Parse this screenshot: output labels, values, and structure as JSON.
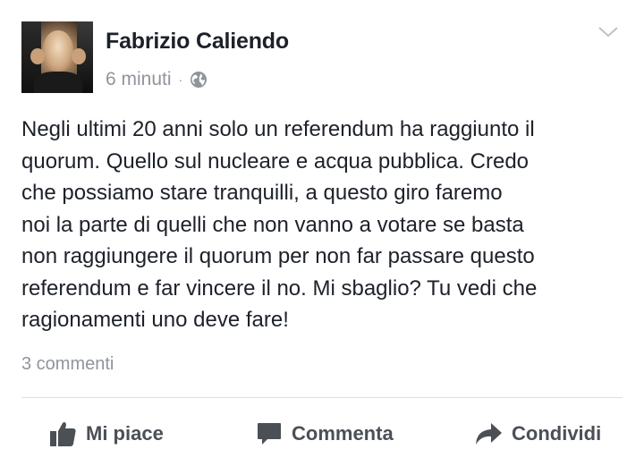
{
  "post": {
    "author": "Fabrizio Caliendo",
    "time": "6 minuti",
    "separator": "·",
    "privacy_icon": "globe-icon",
    "menu_icon": "chevron-down-icon",
    "text_lines": [
      "Negli ultimi 20 anni solo un referendum ha raggiunto il",
      "quorum. Quello sul nucleare e acqua pubblica. Credo",
      "che possiamo stare tranquilli, a questo giro faremo",
      "noi la parte di quelli che non vanno a votare se basta",
      "non raggiungere il quorum per non far passare questo",
      "referendum e far vincere il no. Mi sbaglio? Tu vedi che",
      "ragionamenti uno deve fare!"
    ],
    "comments_count": "3 commenti"
  },
  "actions": {
    "like_label": "Mi piace",
    "like_icon": "thumbs-up-icon",
    "comment_label": "Commenta",
    "comment_icon": "speech-bubble-icon",
    "share_label": "Condividi",
    "share_icon": "share-arrow-icon"
  },
  "colors": {
    "text": "#1d2129",
    "meta": "#90949c",
    "action": "#4b4f56",
    "divider": "#dddfe2"
  }
}
